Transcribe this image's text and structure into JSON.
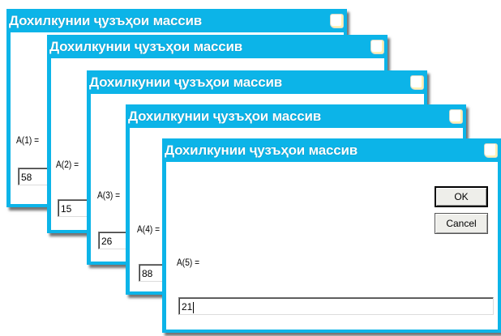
{
  "dialogs": [
    {
      "title": "Дохилкунии ҷузъҳои массив",
      "prompt": "A(1) =",
      "value": "58"
    },
    {
      "title": "Дохилкунии ҷузъҳои массив",
      "prompt": "A(2) =",
      "value": "15"
    },
    {
      "title": "Дохилкунии ҷузъҳои массив",
      "prompt": "A(3) =",
      "value": "26"
    },
    {
      "title": "Дохилкунии ҷузъҳои массив",
      "prompt": "A(4) =",
      "value": "88"
    },
    {
      "title": "Дохилкунии ҷузъҳои массив",
      "prompt": "A(5) =",
      "value": "21",
      "ok_label": "OK",
      "cancel_label": "Cancel"
    }
  ]
}
